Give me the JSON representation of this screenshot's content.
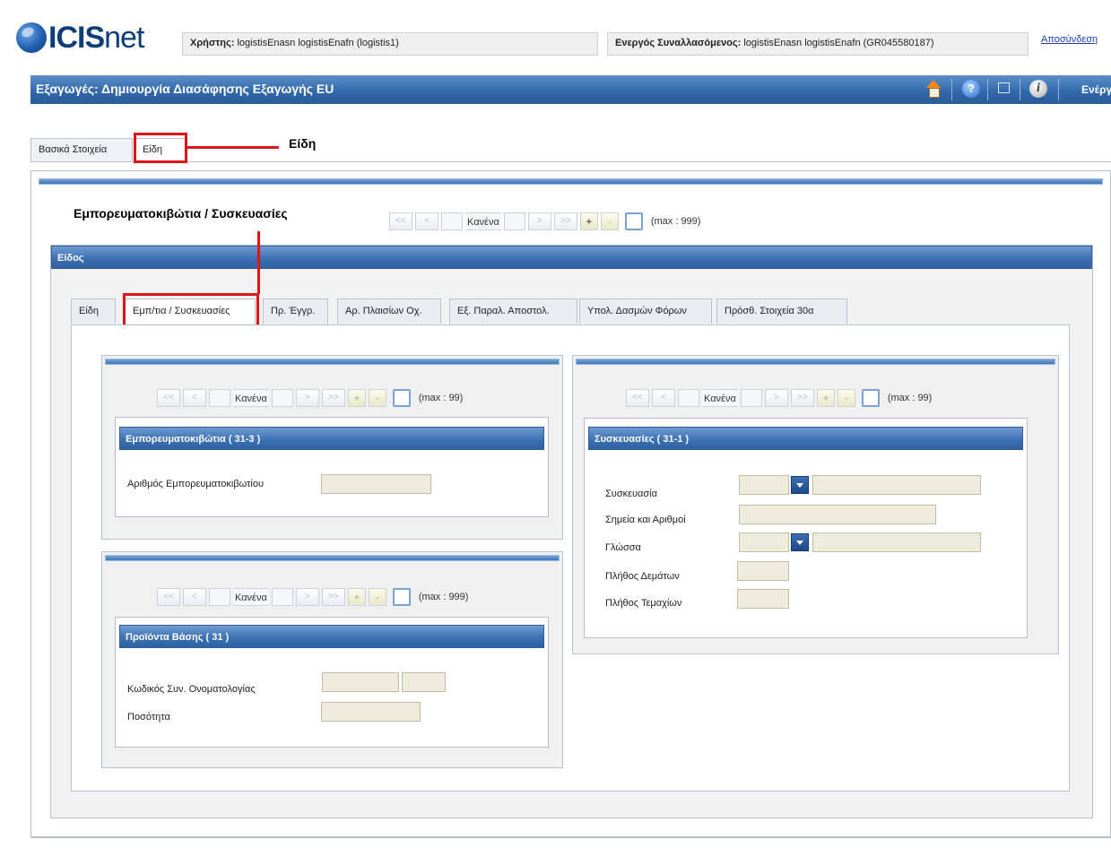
{
  "header": {
    "logo_text_a": "ICIS",
    "logo_text_b": "net",
    "user_label": "Χρήστης:",
    "user_value": "logistisEnasn logistisEnafn (logistis1)",
    "active_label": "Ενεργός Συναλλασόμενος:",
    "active_value": "logistisEnasn logistisEnafn (GR045580187)",
    "logout": "Αποσύνδεση"
  },
  "titlebar": {
    "title": "Εξαγωγές: Δημιουργία Διασάφησης Εξαγωγής EU",
    "help_glyph": "?",
    "info_glyph": "i",
    "actions": "Ενέργειες",
    "icons": [
      "home-icon",
      "help-icon",
      "window-icon",
      "info-icon"
    ]
  },
  "top_tabs": [
    "Βασικά Στοιχεία",
    "Είδη"
  ],
  "callouts": {
    "eidi": "Είδη",
    "containers": "Εμπορευματοκιβώτια / Συσκευασίες"
  },
  "pager_main": {
    "label": "Κανένα",
    "max": "(max : 999)"
  },
  "item_panel": {
    "header": "Είδος",
    "tabs": [
      "Είδη",
      "Εμπ/τια / Συσκευασίες",
      "Πρ. Έγγρ.",
      "Αρ. Πλαισίων Οχ.",
      "Εξ. Παραλ. Αποστολ.",
      "Υπολ. Δασμών Φόρων",
      "Πρόσθ. Στοιχεία 30α"
    ]
  },
  "pager_buttons": {
    "first": "<<",
    "prev": "<",
    "next": ">",
    "last": ">>",
    "plus": "+",
    "minus": "-"
  },
  "containers": {
    "pager_label": "Κανένα",
    "pager_max": "(max : 99)",
    "header": "Εμπορευματοκιβώτια ( 31-3 )",
    "field_label": "Αριθμός Εμπορευματοκιβωτίου",
    "field_value": ""
  },
  "products": {
    "pager_label": "Κανένα",
    "pager_max": "(max : 999)",
    "header": "Προϊόντα Βάσης ( 31 )",
    "code_label": "Κωδικός Συν. Ονοματολογίας",
    "qty_label": "Ποσότητα"
  },
  "packages": {
    "pager_label": "Κανένα",
    "pager_max": "(max : 99)",
    "header": "Συσκευασίες ( 31-1 )",
    "package_label": "Συσκευασία",
    "marks_label": "Σημεία και Αριθμοί",
    "language_label": "Γλώσσα",
    "bundles_label": "Πλήθος Δεμάτων",
    "pieces_label": "Πλήθος Τεμαχίων"
  },
  "colors": {
    "title_blue": "#2f67a9",
    "highlight_red": "#e01515",
    "input_bg": "#efebdd"
  }
}
